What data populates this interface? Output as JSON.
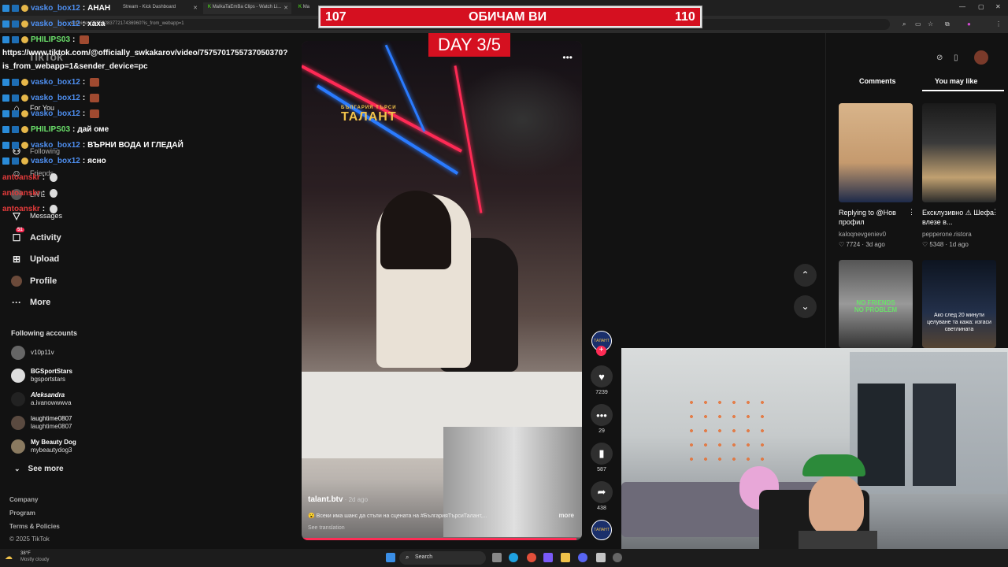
{
  "browser": {
    "tabs": [
      {
        "label": "Stream - Kick Dashboard"
      },
      {
        "label": "MaIkaTaEmBa Clips - Watch Li..."
      },
      {
        "label": "Ma"
      }
    ],
    "url": "ebt/video/7575228377217436960?is_from_webapp=1"
  },
  "overlay": {
    "left_score": "107",
    "title": "ОБИЧАМ ВИ",
    "right_score": "110",
    "day": "DAY 3/5"
  },
  "chat": [
    {
      "user": "vasko_box12",
      "sep": " : ",
      "text": "АНАН",
      "color": "blue"
    },
    {
      "user": "vasko_box12",
      "sep": " : ",
      "text": "хаха",
      "color": "blue"
    },
    {
      "user": "PHILIPS03",
      "sep": " :",
      "text": "",
      "color": "green"
    },
    {
      "user": "",
      "sep": "",
      "text": "https://www.tiktok.com/@officially_swkakarov/video/7575701755737050370?",
      "color": "white"
    },
    {
      "user": "",
      "sep": "",
      "text": "is_from_webapp=1&sender_device=pc",
      "color": "white"
    },
    {
      "user": "vasko_box12",
      "sep": " : ",
      "text": "",
      "color": "blue"
    },
    {
      "user": "vasko_box12",
      "sep": " : ",
      "text": "",
      "color": "blue"
    },
    {
      "user": "vasko_box12",
      "sep": " : ",
      "text": "",
      "color": "blue"
    },
    {
      "user": "PHILIPS03",
      "sep": " : ",
      "text": "дай оме",
      "color": "green"
    },
    {
      "user": "vasko_box12",
      "sep": " : ",
      "text": "ВЪРНИ ВОДА И ГЛЕДАЙ",
      "color": "blue"
    },
    {
      "user": "vasko_box12",
      "sep": " : ",
      "text": "ясно",
      "color": "blue"
    },
    {
      "user": "antoanskr",
      "sep": " : ",
      "text": "",
      "color": "red"
    },
    {
      "user": "antoanskr",
      "sep": " : ",
      "text": "",
      "color": "red"
    },
    {
      "user": "antoanskr",
      "sep": " : ",
      "text": "",
      "color": "red"
    }
  ],
  "leftnav": {
    "items": [
      {
        "label": "For You",
        "icon": "home-icon"
      },
      {
        "label": "Following",
        "icon": "following-icon"
      },
      {
        "label": "Friends",
        "icon": "friends-icon"
      },
      {
        "label": "LIVE",
        "icon": "live-icon"
      },
      {
        "label": "Messages",
        "icon": "messages-icon"
      },
      {
        "label": "Activity",
        "icon": "activity-icon",
        "badge": "51"
      },
      {
        "label": "Upload",
        "icon": "upload-icon"
      },
      {
        "label": "Profile",
        "icon": "profile-icon"
      },
      {
        "label": "More",
        "icon": "more-icon"
      }
    ],
    "following_title": "Following accounts",
    "accounts": [
      {
        "name": "",
        "handle": "v10p11v"
      },
      {
        "name": "BGSportStars",
        "handle": "bgsportstars"
      },
      {
        "name": "Aleksandra",
        "handle": "a.ivanowwwva"
      },
      {
        "name": "laughtime0807",
        "handle": "laughtime0807"
      },
      {
        "name": "My Beauty Dog",
        "handle": "mybeautydog3"
      }
    ],
    "see_more": "See more",
    "footer": [
      "Company",
      "Program",
      "Terms & Policies"
    ],
    "copyright": "© 2025 TikTok"
  },
  "video": {
    "logo_small": "БЪЛГАРИЯ ТЪРСИ",
    "logo_big": "ТАЛАНТ",
    "author": "talant.btv",
    "age": " · 2d ago",
    "description": "Всеки има шанс да стъпи на сцената на #БългарияТърсиТалант,...",
    "more": "more",
    "see_translation": "See translation",
    "progress": 0.98,
    "likes": "7239",
    "comments": "29",
    "saves": "587",
    "shares": "438",
    "avatar_text": "ТАЛАНТ"
  },
  "rightpanel": {
    "tabs": [
      "Comments",
      "You may like"
    ],
    "cards": [
      {
        "caption": "Replying to @Нов профил",
        "author": "kaloqnevgeniev0",
        "stats": "7724 · 3d ago"
      },
      {
        "caption": "Ексклузивно ⚠ Шефа влезе в...",
        "author": "pepperone.ristora",
        "stats": "5348 · 1d ago"
      },
      {
        "caption": "",
        "author": "",
        "stats": ""
      },
      {
        "caption": "",
        "author": "",
        "stats": ""
      }
    ],
    "card3_text": "NO FRIENDS\nNO PROBLEM",
    "card4_text": "Ако след 20 минути целуване та кажа: изгаси светлината"
  },
  "taskbar": {
    "weather_temp": "38°F",
    "weather_text": "Mostly cloudy",
    "search": "Search"
  },
  "colors": {
    "accent": "#fe2c55",
    "overlay_red": "#d51020",
    "chat_blue": "#4e8ff0",
    "chat_green": "#6be06b",
    "chat_red": "#e03a3a"
  }
}
